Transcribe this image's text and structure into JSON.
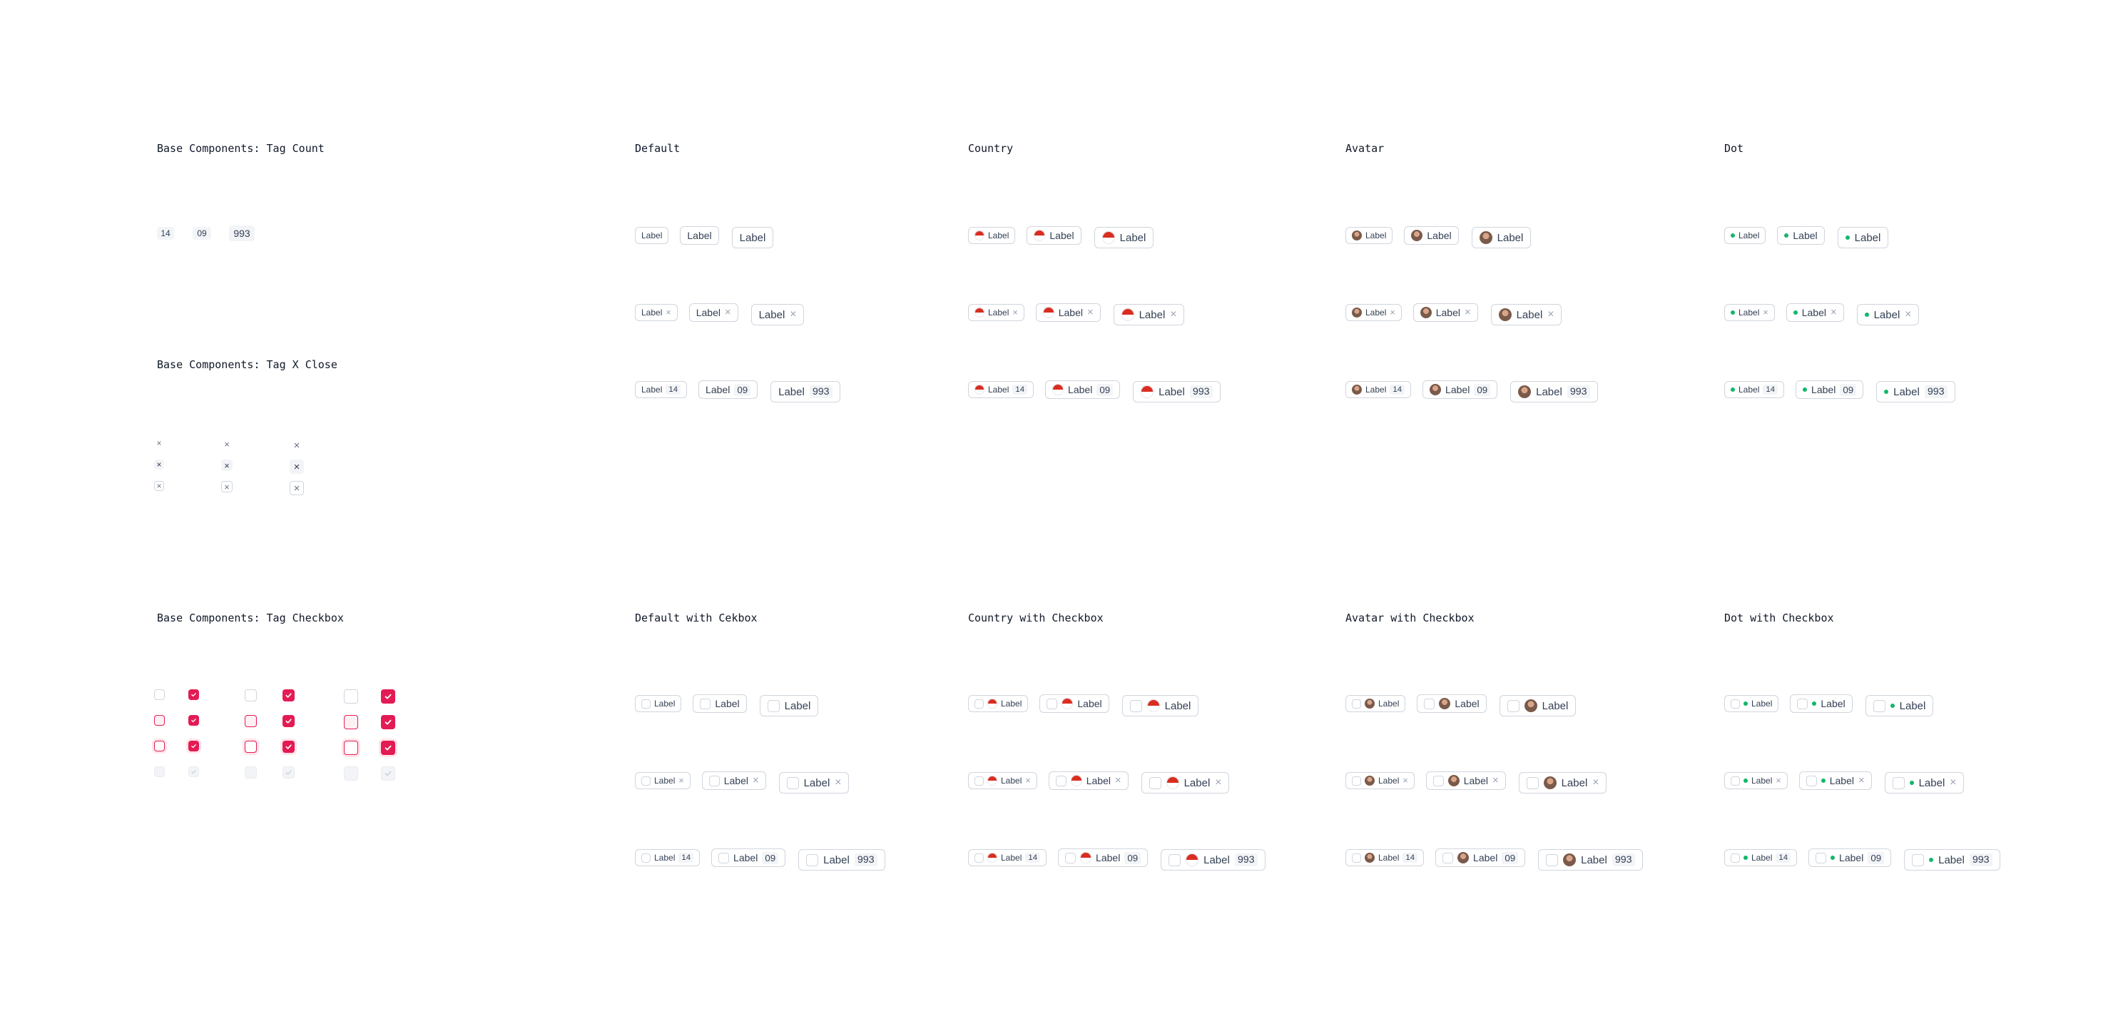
{
  "sections": {
    "tag_count": "Base Components: Tag Count",
    "tag_x_close": "Base Components: Tag X Close",
    "tag_checkbox": "Base Components: Tag Checkbox",
    "default": "Default",
    "country": "Country",
    "avatar": "Avatar",
    "dot": "Dot",
    "default_cb": "Default with Cekbox",
    "country_cb": "Country with Checkbox",
    "avatar_cb": "Avatar with Checkbox",
    "dot_cb": "Dot with Checkbox"
  },
  "tag": {
    "label": "Label",
    "close_glyph": "×",
    "counts": {
      "sm": "14",
      "md": "09",
      "lg": "993"
    }
  },
  "icons": {
    "close": "close-icon",
    "check": "check-icon",
    "flag": "flag-icon",
    "avatar": "avatar-icon",
    "dot": "status-dot-icon"
  },
  "colors": {
    "accent": "#e31b54",
    "dot": "#12b76a",
    "border": "#d0d5dd",
    "text": "#344054"
  }
}
